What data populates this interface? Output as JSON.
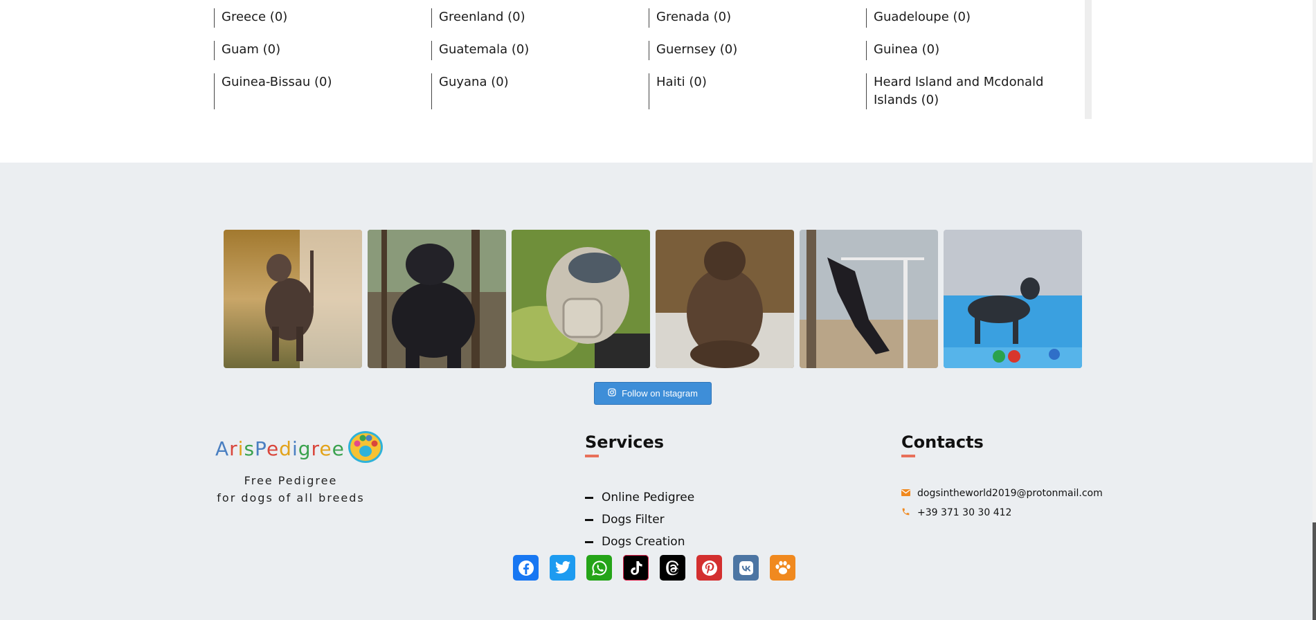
{
  "countries": {
    "rows": [
      [
        "Greece (0)",
        "Greenland (0)",
        "Grenada (0)",
        "Guadeloupe (0)"
      ],
      [
        "Guam (0)",
        "Guatemala (0)",
        "Guernsey (0)",
        "Guinea (0)"
      ],
      [
        "Guinea-Bissau (0)",
        "Guyana (0)",
        "Haiti (0)",
        "Heard Island and Mcdonald Islands (0)"
      ]
    ]
  },
  "instagram": {
    "follow_label": "Follow on Istagram",
    "photos": [
      "pointer-dog-photo",
      "black-mastiff-photo",
      "muzzled-dog-photo",
      "brindle-mastiff-photo",
      "jumping-doberman-photo",
      "show-dog-photo"
    ]
  },
  "brand": {
    "name_letters": [
      "A",
      "r",
      "i",
      "s",
      "P",
      "e",
      "d",
      "i",
      "g",
      "r",
      "e",
      "e"
    ],
    "name_colors": [
      "#4a7fc1",
      "#d9453b",
      "#e2a31b",
      "#3aa24e",
      "#4a7fc1",
      "#d9453b",
      "#e2a31b",
      "#4a7fc1",
      "#3aa24e",
      "#d9453b",
      "#e2a31b",
      "#3aa24e"
    ],
    "tagline_1": "Free Pedigree",
    "tagline_2": "for dogs of all breeds"
  },
  "services": {
    "title": "Services",
    "items": [
      "Online Pedigree",
      "Dogs Filter",
      "Dogs Creation"
    ]
  },
  "contacts": {
    "title": "Contacts",
    "email": "dogsintheworld2019@protonmail.com",
    "phone": "+39 371 30 30 412"
  },
  "socials": [
    {
      "name": "facebook-icon",
      "color": "#1877f2"
    },
    {
      "name": "twitter-icon",
      "color": "#1d9bf0"
    },
    {
      "name": "whatsapp-icon",
      "color": "#25a418"
    },
    {
      "name": "tiktok-icon",
      "color": "#000000"
    },
    {
      "name": "threads-icon",
      "color": "#000000"
    },
    {
      "name": "pinterest-icon",
      "color": "#d32f2f"
    },
    {
      "name": "vk-icon",
      "color": "#4c75a3"
    },
    {
      "name": "paw-icon",
      "color": "#f0891f"
    }
  ],
  "colors": {
    "accent_underline": "#e8705a",
    "footer_bg": "#ebeef1",
    "follow_button": "#3e8ed8"
  }
}
